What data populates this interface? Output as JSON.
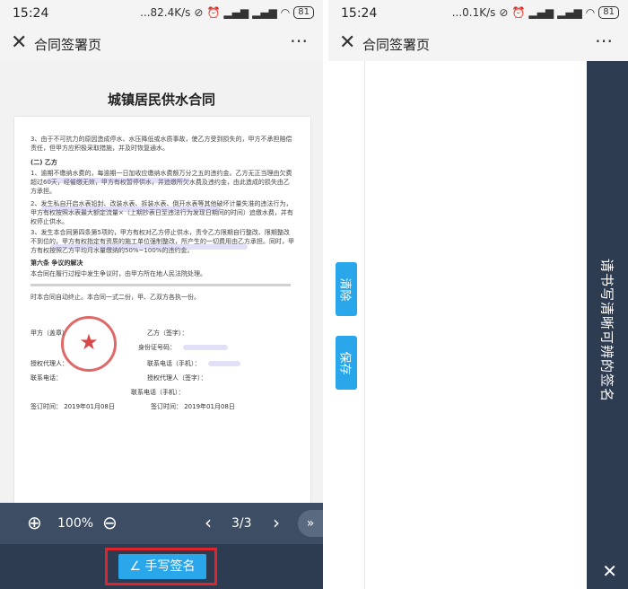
{
  "left": {
    "status": {
      "time": "15:24",
      "speed": "...82.4K/s",
      "battery": "81"
    },
    "nav": {
      "title": "合同签署页"
    },
    "document": {
      "title": "城镇居民供水合同",
      "para1": "3、由于不可抗力的原因造成停水、水压降低或水质事故，使乙方受到损失的，甲方不承担赔偿责任，但甲方应积极采取措施，并及时恢复通水。",
      "section_b": "(二) 乙方",
      "para2": "1、逾期不缴纳水费的，每逾期一日加收应缴纳水费额万分之五的违约金。乙方无正当理由欠费超过60天，经催缴无效，甲方有权暂停供水，并追缴所欠水费及违约金，由此造成的损失由乙方承担。",
      "para3": "2、发生私自开启水表铅封、改装水表、拆装水表、倒开水表等其他破坏计量失准的违法行为，甲方有权按照水表最大额定流量×（上期抄表日至违法行为发现日期间的时间）追缴水费，并有权停止供水。",
      "para4": "3、发生本合同第四条第5项的，甲方有权对乙方停止供水，责令乙方限期自行整改、限期整改不到位的，甲方有权指定有资质的施工单位强制整改，所产生的一切费用由乙方承担。同时，甲方有权按照乙方平均月水量缴纳的50%~100%的违约金。",
      "article6": "第六条   争议的解决",
      "para5": "本合同在履行过程中发生争议时，由甲方所在地人民法院处理。",
      "para6": "时本合同自动终止。本合同一式二份，甲、乙双方各执一份。",
      "party_a": "甲方（盖章）",
      "party_b": "乙方（签字）：",
      "id_no": "身份证号码：",
      "agent_a": "授权代理人：",
      "phone_mobile": "联系电话（手机）：",
      "contact_a": "联系电话：",
      "agent_b": "授权代理人（签字）：",
      "phone_mobile2": "联系电话（手机）：",
      "sign_time_a": "签订时间：  2019年01月08日",
      "sign_time_b": "签订时间：  2019年01月08日"
    },
    "toolbar": {
      "zoom": "100%",
      "page": "3/3"
    },
    "sign_button": "手写签名"
  },
  "right": {
    "status": {
      "time": "15:24",
      "speed": "...0.1K/s",
      "battery": "81"
    },
    "nav": {
      "title": "合同签署页"
    },
    "clear_button": "清除",
    "save_button": "保存",
    "hint": "请书写清晰可辨的签名"
  },
  "colors": {
    "accent": "#2aa7ea",
    "toolbar": "#3d4d63",
    "dark_bar": "#2e3c52",
    "highlight": "#e0242b"
  }
}
